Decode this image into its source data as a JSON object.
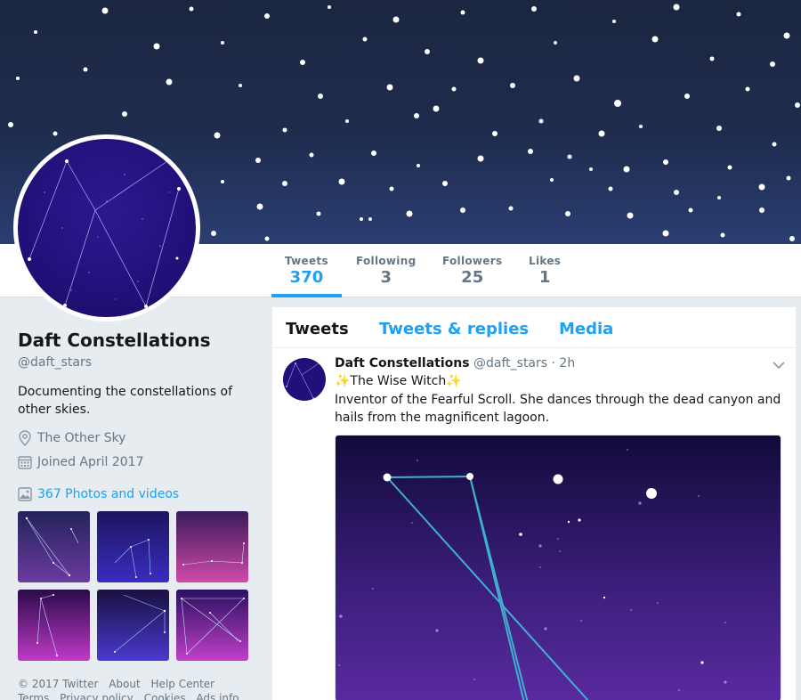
{
  "profile": {
    "name": "Daft Constellations",
    "handle": "@daft_stars",
    "bio": "Documenting the constellations of other skies.",
    "location": "The Other Sky",
    "joined": "Joined April 2017",
    "photos_link": "367 Photos and videos"
  },
  "nav": {
    "stats": [
      {
        "label": "Tweets",
        "value": "370"
      },
      {
        "label": "Following",
        "value": "3"
      },
      {
        "label": "Followers",
        "value": "25"
      },
      {
        "label": "Likes",
        "value": "1"
      }
    ]
  },
  "timeline": {
    "tabs": [
      "Tweets",
      "Tweets & replies",
      "Media"
    ]
  },
  "tweet": {
    "name": "Daft Constellations",
    "handle": "@daft_stars",
    "time": "· 2h",
    "title_line": "✨The Wise Witch✨",
    "body": "Inventor of the Fearful Scroll. She dances through the dead canyon and hails from the magnificent lagoon."
  },
  "footer": {
    "links": [
      "© 2017 Twitter",
      "About",
      "Help Center",
      "Terms",
      "Privacy policy",
      "Cookies",
      "Ads info"
    ]
  },
  "icons": {
    "location": "location-pin-icon",
    "calendar": "calendar-icon",
    "photos": "image-icon",
    "caret": "chevron-down-icon"
  },
  "colors": {
    "accent": "#1da1f2",
    "muted": "#657786",
    "text": "#14171a",
    "background": "#e6ecf0"
  }
}
